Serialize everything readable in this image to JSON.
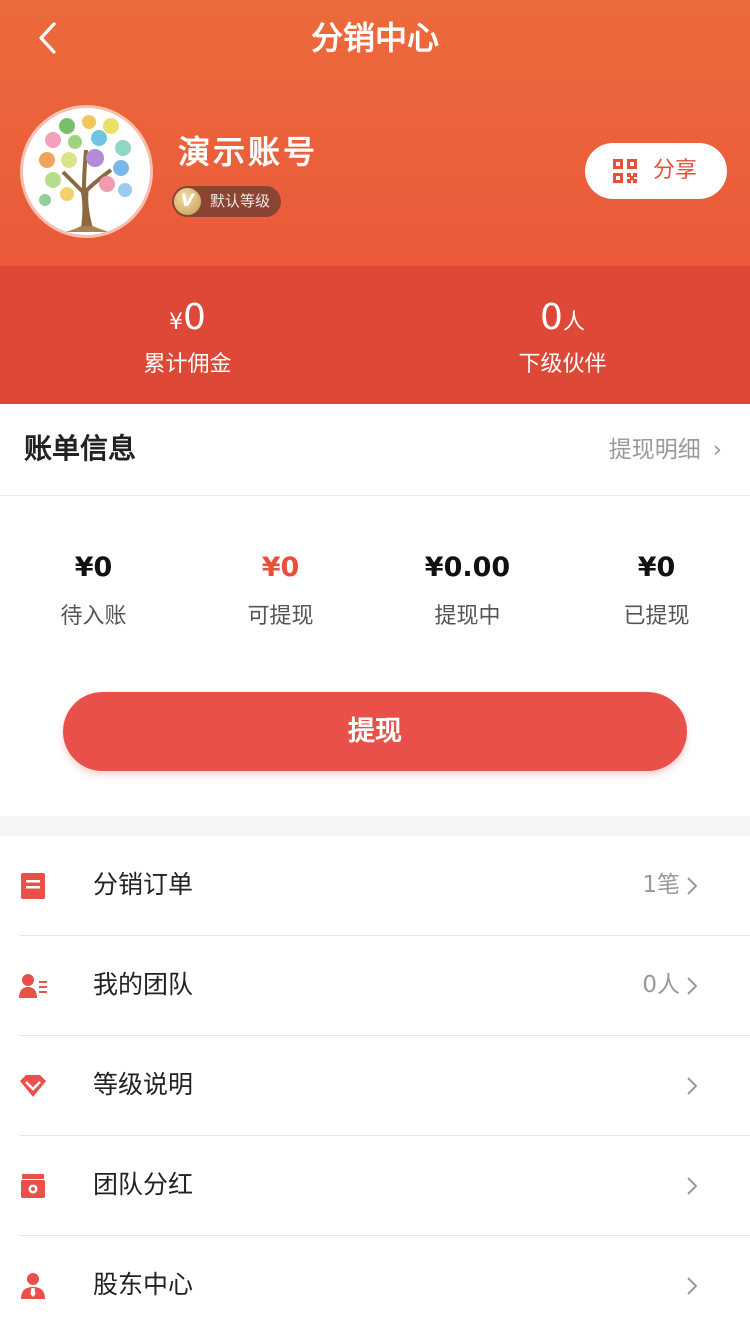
{
  "nav": {
    "title": "分销中心"
  },
  "user": {
    "name": "演示账号",
    "level_badge_letter": "V",
    "level": "默认等级"
  },
  "share": {
    "label": "分享"
  },
  "stats": {
    "commission": {
      "currency": "¥",
      "value": "0",
      "label": "累计佣金"
    },
    "partners": {
      "value": "0",
      "unit": "人",
      "label": "下级伙伴"
    }
  },
  "bill": {
    "title": "账单信息",
    "detail_link": "提现明细",
    "chevron": "›",
    "amounts": [
      {
        "value": "¥0",
        "label": "待入账"
      },
      {
        "value": "¥0",
        "label": "可提现"
      },
      {
        "value": "¥0.00",
        "label": "提现中"
      },
      {
        "value": "¥0",
        "label": "已提现"
      }
    ]
  },
  "withdraw_button": {
    "label": "提现"
  },
  "menu": [
    {
      "label": "分销订单",
      "extra": "1笔",
      "icon": "order-icon"
    },
    {
      "label": "我的团队",
      "extra": "0人",
      "icon": "team-icon"
    },
    {
      "label": "等级说明",
      "extra": "",
      "icon": "diamond-icon"
    },
    {
      "label": "团队分红",
      "extra": "",
      "icon": "dividend-icon"
    },
    {
      "label": "股东中心",
      "extra": "",
      "icon": "shareholder-icon"
    }
  ],
  "colors": {
    "brand": "#e9503a",
    "brand_light": "#ec6a3b",
    "strip": "#de4836"
  }
}
